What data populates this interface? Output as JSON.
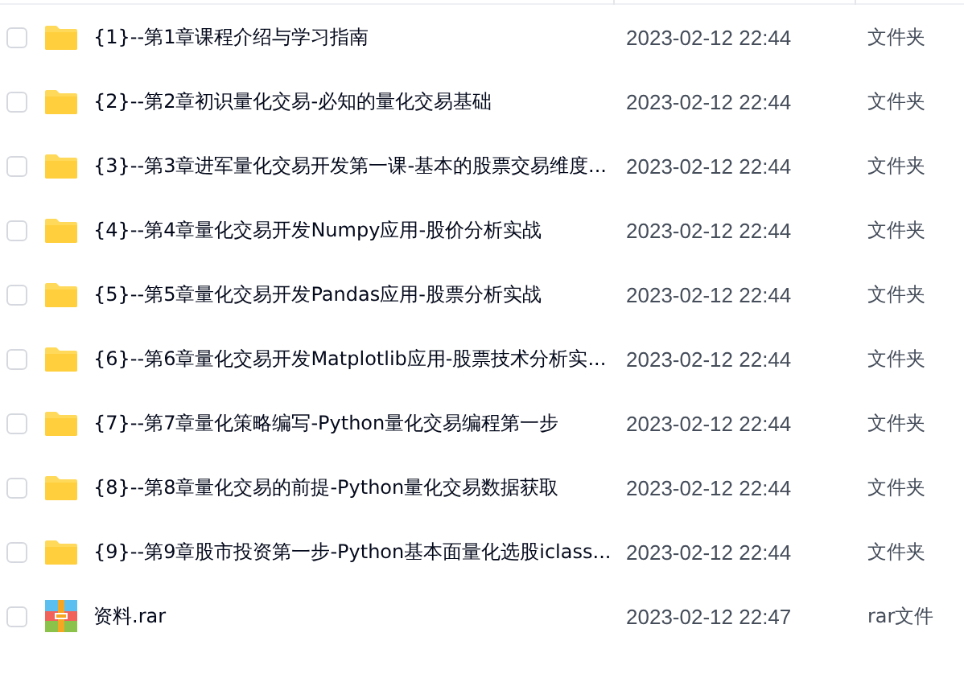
{
  "files": [
    {
      "kind": "folder",
      "name": "{1}--第1章课程介绍与学习指南",
      "modified": "2023-02-12 22:44",
      "type": "文件夹",
      "checked": false
    },
    {
      "kind": "folder",
      "name": "{2}--第2章初识量化交易-必知的量化交易基础",
      "modified": "2023-02-12 22:44",
      "type": "文件夹",
      "checked": false
    },
    {
      "kind": "folder",
      "name": "{3}--第3章进军量化交易开发第一课-基本的股票交易维度...",
      "modified": "2023-02-12 22:44",
      "type": "文件夹",
      "checked": false
    },
    {
      "kind": "folder",
      "name": "{4}--第4章量化交易开发Numpy应用-股价分析实战",
      "modified": "2023-02-12 22:44",
      "type": "文件夹",
      "checked": false
    },
    {
      "kind": "folder",
      "name": "{5}--第5章量化交易开发Pandas应用-股票分析实战",
      "modified": "2023-02-12 22:44",
      "type": "文件夹",
      "checked": false
    },
    {
      "kind": "folder",
      "name": "{6}--第6章量化交易开发Matplotlib应用-股票技术分析实...",
      "modified": "2023-02-12 22:44",
      "type": "文件夹",
      "checked": false
    },
    {
      "kind": "folder",
      "name": "{7}--第7章量化策略编写-Python量化交易编程第一步",
      "modified": "2023-02-12 22:44",
      "type": "文件夹",
      "checked": false
    },
    {
      "kind": "folder",
      "name": "{8}--第8章量化交易的前提-Python量化交易数据获取",
      "modified": "2023-02-12 22:44",
      "type": "文件夹",
      "checked": false
    },
    {
      "kind": "folder",
      "name": "{9}--第9章股市投资第一步-Python基本面量化选股iclass...",
      "modified": "2023-02-12 22:44",
      "type": "文件夹",
      "checked": false
    },
    {
      "kind": "archive",
      "name": "资料.rar",
      "modified": "2023-02-12 22:47",
      "type": "rar文件",
      "checked": false
    }
  ]
}
